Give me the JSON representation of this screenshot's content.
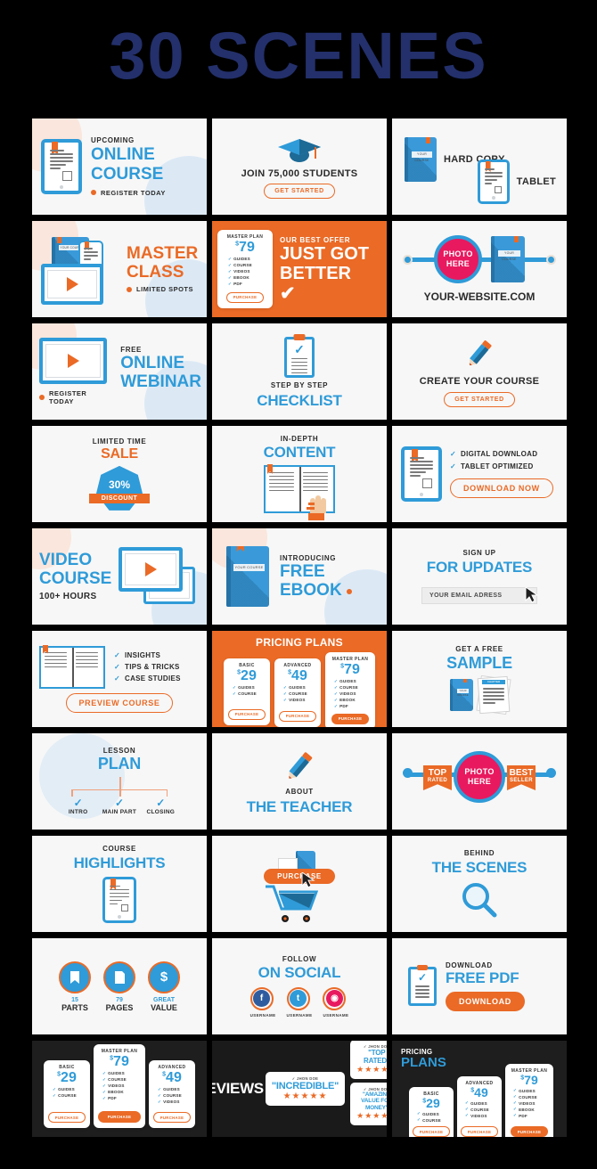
{
  "header": {
    "title": "30 SCENES"
  },
  "colors": {
    "blue": "#2f9bd8",
    "orange": "#ea6a26",
    "navy": "#23306b",
    "pink": "#e8195f",
    "dark": "#1e1e1e"
  },
  "scenes": [
    {
      "id": 1,
      "name": "upcoming-online-course",
      "kicker": "UPCOMING",
      "title1": "ONLINE",
      "title2": "COURSE",
      "cta": "REGISTER TODAY"
    },
    {
      "id": 2,
      "name": "join-students",
      "headline": "JOIN 75,000 STUDENTS",
      "button": "GET STARTED"
    },
    {
      "id": 3,
      "name": "hard-copy-tablet",
      "label1": "HARD COPY",
      "label2": "TABLET",
      "book_label": "YOUR COURSE"
    },
    {
      "id": 4,
      "name": "master-class",
      "title1": "MASTER",
      "title2": "CLASS",
      "cta": "LIMITED SPOTS",
      "book_label": "YOUR COURSE"
    },
    {
      "id": 5,
      "name": "best-offer",
      "kicker": "OUR BEST OFFER",
      "title1": "JUST GOT",
      "title2": "BETTER",
      "plan": {
        "name": "MASTER PLAN",
        "currency": "$",
        "price": "79",
        "features": [
          "GUIDES",
          "COURSE",
          "VIDEOS",
          "EBOOK",
          "PDF"
        ],
        "button": "PURCHASE"
      }
    },
    {
      "id": 6,
      "name": "website-photo",
      "photo1": "PHOTO",
      "photo2": "HERE",
      "url": "YOUR-WEBSITE.COM",
      "book_label": "YOUR COURSE"
    },
    {
      "id": 7,
      "name": "free-online-webinar",
      "kicker": "FREE",
      "title1": "ONLINE",
      "title2": "WEBINAR",
      "cta": "REGISTER TODAY"
    },
    {
      "id": 8,
      "name": "step-by-step-checklist",
      "kicker": "STEP BY STEP",
      "title": "CHECKLIST"
    },
    {
      "id": 9,
      "name": "create-your-course",
      "headline": "CREATE YOUR COURSE",
      "button": "GET STARTED"
    },
    {
      "id": 10,
      "name": "limited-time-sale",
      "kicker": "LIMITED TIME",
      "title": "SALE",
      "percent": "30%",
      "badge": "DISCOUNT"
    },
    {
      "id": 11,
      "name": "in-depth-content",
      "kicker": "IN-DEPTH",
      "title": "CONTENT"
    },
    {
      "id": 12,
      "name": "digital-download",
      "feature1": "DIGITAL DOWNLOAD",
      "feature2": "TABLET OPTIMIZED",
      "button": "DOWNLOAD NOW"
    },
    {
      "id": 13,
      "name": "video-course",
      "title1": "VIDEO",
      "title2": "COURSE",
      "sub": "100+ HOURS"
    },
    {
      "id": 14,
      "name": "free-ebook",
      "kicker": "INTRODUCING",
      "title1": "FREE",
      "title2": "EBOOK",
      "book_label": "YOUR COURSE"
    },
    {
      "id": 15,
      "name": "sign-up-for-updates",
      "kicker": "SIGN UP",
      "title": "FOR UPDATES",
      "placeholder": "YOUR EMAIL ADRESS"
    },
    {
      "id": 16,
      "name": "course-benefits",
      "f1": "INSIGHTS",
      "f2": "TIPS & TRICKS",
      "f3": "CASE STUDIES",
      "button": "PREVIEW COURSE"
    },
    {
      "id": 17,
      "name": "pricing-plans-orange",
      "title": "PRICING PLANS",
      "plans": [
        {
          "name": "BASIC",
          "currency": "$",
          "price": "29",
          "features": [
            "GUIDES",
            "COURSE"
          ],
          "button": "PURCHASE",
          "featured": false
        },
        {
          "name": "ADVANCED",
          "currency": "$",
          "price": "49",
          "features": [
            "GUIDES",
            "COURSE",
            "VIDEOS"
          ],
          "button": "PURCHASE",
          "featured": false
        },
        {
          "name": "MASTER PLAN",
          "currency": "$",
          "price": "79",
          "features": [
            "GUIDES",
            "COURSE",
            "VIDEOS",
            "EBOOK",
            "PDF"
          ],
          "button": "PURCHASE",
          "featured": true
        }
      ]
    },
    {
      "id": 18,
      "name": "get-a-free-sample",
      "kicker": "GET A FREE",
      "title": "SAMPLE",
      "book_label": "YOUR COURSE",
      "paper_label": "CHAPTER"
    },
    {
      "id": 19,
      "name": "lesson-plan",
      "kicker": "LESSON",
      "title": "PLAN",
      "steps": [
        "INTRO",
        "MAIN PART",
        "CLOSING"
      ]
    },
    {
      "id": 20,
      "name": "about-the-teacher",
      "kicker": "ABOUT",
      "title": "THE TEACHER"
    },
    {
      "id": 21,
      "name": "top-rated-best-seller",
      "left_t1": "TOP",
      "left_t2": "RATED",
      "photo1": "PHOTO",
      "photo2": "HERE",
      "right_t1": "BEST",
      "right_t2": "SELLER"
    },
    {
      "id": 22,
      "name": "course-highlights",
      "kicker": "COURSE",
      "title": "HIGHLIGHTS"
    },
    {
      "id": 23,
      "name": "purchase-cart",
      "button": "PURCHASE"
    },
    {
      "id": 24,
      "name": "behind-the-scenes",
      "kicker": "BEHIND",
      "title": "THE SCENES"
    },
    {
      "id": 25,
      "name": "course-stats",
      "stats": [
        {
          "value": "15",
          "label": "PARTS",
          "icon": "bookmark-icon"
        },
        {
          "value": "79",
          "label": "PAGES",
          "icon": "page-icon"
        },
        {
          "value": "GREAT",
          "label": "VALUE",
          "icon": "dollar-icon"
        }
      ]
    },
    {
      "id": 26,
      "name": "follow-on-social",
      "kicker": "FOLLOW",
      "title": "ON SOCIAL",
      "accounts": [
        {
          "network": "facebook-icon",
          "glyph": "f",
          "color": "#2f5c9e",
          "username": "USERNAME"
        },
        {
          "network": "twitter-icon",
          "glyph": "t",
          "color": "#2f9bd8",
          "username": "USERNAME"
        },
        {
          "network": "instagram-icon",
          "glyph": "i",
          "color": "#e8195f",
          "username": "USERNAME"
        }
      ]
    },
    {
      "id": 27,
      "name": "download-free-pdf",
      "kicker": "DOWNLOAD",
      "title": "FREE PDF",
      "button": "DOWNLOAD"
    },
    {
      "id": 28,
      "name": "pricing-dark",
      "plans": [
        {
          "name": "BASIC",
          "currency": "$",
          "price": "29",
          "features": [
            "GUIDES",
            "COURSE"
          ],
          "button": "PURCHASE",
          "featured": false
        },
        {
          "name": "MASTER PLAN",
          "currency": "$",
          "price": "79",
          "features": [
            "GUIDES",
            "COURSE",
            "VIDEOS",
            "EBOOK",
            "PDF"
          ],
          "button": "PURCHASE",
          "featured": true
        },
        {
          "name": "ADVANCED",
          "currency": "$",
          "price": "49",
          "features": [
            "GUIDES",
            "COURSE",
            "VIDEOS"
          ],
          "button": "PURCHASE",
          "featured": false
        }
      ]
    },
    {
      "id": 29,
      "name": "reviews-dark",
      "title": "REVIEWS",
      "reviews": [
        {
          "author": "JHON DOE",
          "quote": "\"INCREDIBLE\"",
          "stars": "★★★★★"
        },
        {
          "author": "JHON DOE",
          "quote": "\"TOP RATED\"",
          "stars": "★★★★★"
        },
        {
          "author": "JHON DOE",
          "quote": "\"AMAZING VALUE FOR MONEY\"",
          "stars": "★★★★★"
        }
      ]
    },
    {
      "id": 30,
      "name": "pricing-plans-dark",
      "kicker": "PRICING",
      "title": "PLANS",
      "plans": [
        {
          "name": "BASIC",
          "currency": "$",
          "price": "29",
          "features": [
            "GUIDES",
            "COURSE"
          ],
          "button": "PURCHASE",
          "featured": false
        },
        {
          "name": "ADVANCED",
          "currency": "$",
          "price": "49",
          "features": [
            "GUIDES",
            "COURSE",
            "VIDEOS"
          ],
          "button": "PURCHASE",
          "featured": false
        },
        {
          "name": "MASTER PLAN",
          "currency": "$",
          "price": "79",
          "features": [
            "GUIDES",
            "COURSE",
            "VIDEOS",
            "EBOOK",
            "PDF"
          ],
          "button": "PURCHASE",
          "featured": true
        }
      ]
    }
  ]
}
